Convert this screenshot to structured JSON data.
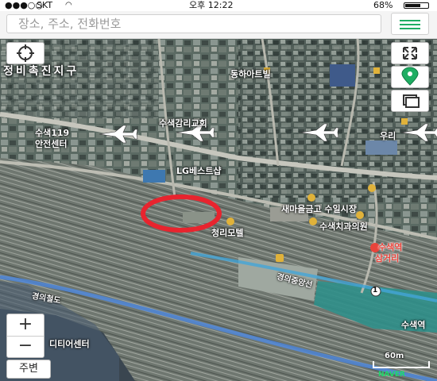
{
  "status": {
    "carrier": "SKT",
    "time": "오후 12:22",
    "battery": "68%"
  },
  "search": {
    "placeholder": "장소, 주소, 전화번호"
  },
  "map": {
    "labels": {
      "district": "정비촉진지구",
      "dongha_apt": "동하아트빌",
      "fire_center_1": "수색119",
      "fire_center_2": "안전센터",
      "church": "수색감리교회",
      "woori": "우리",
      "lg_bestshop": "LG베스트샵",
      "saemaul": "새마을금고 수일시장",
      "dental": "수색치과의원",
      "station_1": "수색역",
      "station_2": "삼거리",
      "motel": "청리모텔",
      "gyeongui_line": "경의중앙선",
      "railway": "경의철도",
      "suseok_station": "수색역",
      "service_center": "디티어센터",
      "exit_number": "1"
    },
    "scale": "60m",
    "scale_logo": "NAVER"
  },
  "controls": {
    "zoom_in": "+",
    "zoom_out": "−",
    "around": "주변"
  },
  "colors": {
    "accent_green": "#1fae63",
    "marker_red": "#e8242e",
    "label_red": "#e8443b"
  }
}
